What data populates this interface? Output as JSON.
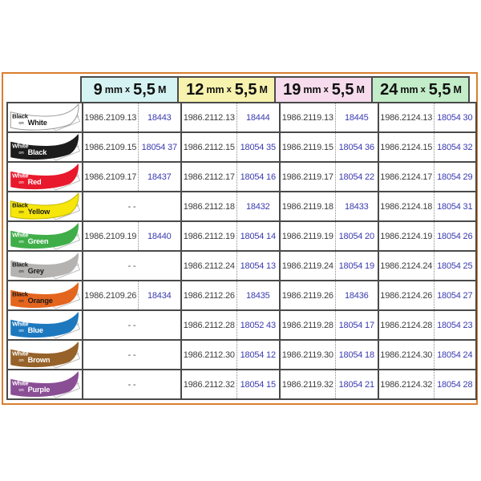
{
  "frame": {
    "border_color": "#d97e2f",
    "background": "#ffffff"
  },
  "header": {
    "unit": "mm",
    "times": "x",
    "length": "5,5",
    "length_unit": "M",
    "cols": [
      {
        "size": "9",
        "bg": "#d5f3f2"
      },
      {
        "size": "12",
        "bg": "#f7f2ae"
      },
      {
        "size": "19",
        "bg": "#f6dcec"
      },
      {
        "size": "24",
        "bg": "#c3edc8"
      }
    ]
  },
  "table": {
    "missing": "- -",
    "colors": {
      "catalog": "#3d3d3d",
      "id": "#3a3ab0",
      "grid": "#4a4a4a",
      "divider": "#8a8a8a"
    },
    "rows": [
      {
        "top": "Black",
        "mid": "on",
        "bottom": "White",
        "tape": "#ffffff",
        "text": "#1a1a1a",
        "edge": "#999999",
        "cells": [
          {
            "cat": "1986.2109.13",
            "id": "18443"
          },
          {
            "cat": "1986.2112.13",
            "id": "18444"
          },
          {
            "cat": "1986.2119.13",
            "id": "18445"
          },
          {
            "cat": "1986.2124.13",
            "id": "18054 30"
          }
        ]
      },
      {
        "top": "White",
        "mid": "on",
        "bottom": "Black",
        "tape": "#1c1c1c",
        "text": "#ffffff",
        "edge": "none",
        "cells": [
          {
            "cat": "1986.2109.15",
            "id": "18054 37"
          },
          {
            "cat": "1986.2112.15",
            "id": "18054 35"
          },
          {
            "cat": "1986.2119.15",
            "id": "18054 36"
          },
          {
            "cat": "1986.2124.15",
            "id": "18054 32"
          }
        ]
      },
      {
        "top": "White",
        "mid": "on",
        "bottom": "Red",
        "tape": "#e8192c",
        "text": "#ffffff",
        "edge": "none",
        "cells": [
          {
            "cat": "1986.2109.17",
            "id": "18437"
          },
          {
            "cat": "1986.2112.17",
            "id": "18054 16"
          },
          {
            "cat": "1986.2119.17",
            "id": "18054 22"
          },
          {
            "cat": "1986.2124.17",
            "id": "18054 29"
          }
        ]
      },
      {
        "top": "Black",
        "mid": "on",
        "bottom": "Yellow",
        "tape": "#f6e60a",
        "text": "#1a1a1a",
        "edge": "#c2b400",
        "cells": [
          null,
          {
            "cat": "1986.2112.18",
            "id": "18432"
          },
          {
            "cat": "1986.2119.18",
            "id": "18433"
          },
          {
            "cat": "1986.2124.18",
            "id": "18054 31"
          }
        ]
      },
      {
        "top": "White",
        "mid": "on",
        "bottom": "Green",
        "tape": "#3fae49",
        "text": "#ffffff",
        "edge": "none",
        "cells": [
          {
            "cat": "1986.2109.19",
            "id": "18440"
          },
          {
            "cat": "1986.2112.19",
            "id": "18054 14"
          },
          {
            "cat": "1986.2119.19",
            "id": "18054 20"
          },
          {
            "cat": "1986.2124.19",
            "id": "18054 26"
          }
        ]
      },
      {
        "top": "Black",
        "mid": "on",
        "bottom": "Grey",
        "tape": "#b5b2b2",
        "text": "#1a1a1a",
        "edge": "none",
        "cells": [
          null,
          {
            "cat": "1986.2112.24",
            "id": "18054 13"
          },
          {
            "cat": "1986.2119.24",
            "id": "18054 19"
          },
          {
            "cat": "1986.2124.24",
            "id": "18054 25"
          }
        ]
      },
      {
        "top": "Black",
        "mid": "on",
        "bottom": "Orange",
        "tape": "#e4651e",
        "text": "#1a1a1a",
        "edge": "none",
        "cells": [
          {
            "cat": "1986.2109.26",
            "id": "18434"
          },
          {
            "cat": "1986.2112.26",
            "id": "18435"
          },
          {
            "cat": "1986.2119.26",
            "id": "18436"
          },
          {
            "cat": "1986.2124.26",
            "id": "18054 27"
          }
        ]
      },
      {
        "top": "White",
        "mid": "on",
        "bottom": "Blue",
        "tape": "#1d78be",
        "text": "#ffffff",
        "edge": "none",
        "cells": [
          null,
          {
            "cat": "1986.2112.28",
            "id": "18052 43"
          },
          {
            "cat": "1986.2119.28",
            "id": "18054 17"
          },
          {
            "cat": "1986.2124.28",
            "id": "18054 23"
          }
        ]
      },
      {
        "top": "White",
        "mid": "on",
        "bottom": "Brown",
        "tape": "#96622a",
        "text": "#ffffff",
        "edge": "none",
        "cells": [
          null,
          {
            "cat": "1986.2112.30",
            "id": "18054 12"
          },
          {
            "cat": "1986.2119.30",
            "id": "18054 18"
          },
          {
            "cat": "1986.2124.30",
            "id": "18054 24"
          }
        ]
      },
      {
        "top": "White",
        "mid": "on",
        "bottom": "Purple",
        "tape": "#8a4e95",
        "text": "#ffffff",
        "edge": "none",
        "cells": [
          null,
          {
            "cat": "1986.2112.32",
            "id": "18054 15"
          },
          {
            "cat": "1986.2119.32",
            "id": "18054 21"
          },
          {
            "cat": "1986.2124.32",
            "id": "18054 28"
          }
        ]
      }
    ]
  }
}
